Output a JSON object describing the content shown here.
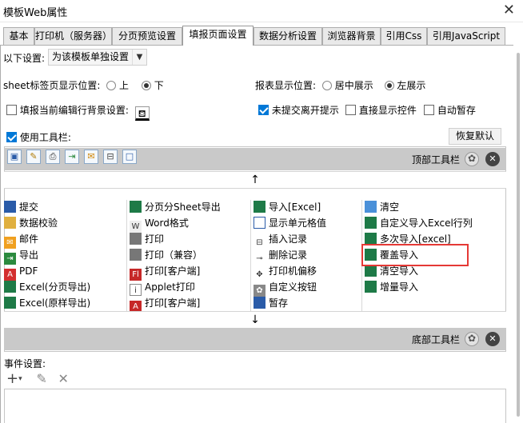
{
  "window": {
    "title": "模板Web属性",
    "close": "✕"
  },
  "tabs": [
    {
      "label": "基本"
    },
    {
      "label": "打印机（服务器）"
    },
    {
      "label": "分页预览设置"
    },
    {
      "label": "填报页面设置"
    },
    {
      "label": "数据分析设置"
    },
    {
      "label": "浏览器背景"
    },
    {
      "label": "引用Css"
    },
    {
      "label": "引用JavaScript"
    }
  ],
  "settings": {
    "label": "以下设置:",
    "select_value": "为该模板单独设置",
    "sheet_pos_label": "sheet标签页显示位置:",
    "sheet_top": "上",
    "sheet_bottom": "下",
    "report_pos_label": "报表显示位置:",
    "report_center": "居中展示",
    "report_left": "左展示",
    "fill_bg_label": "填报当前编辑行背景设置:",
    "unsubmitted_label": "未提交离开提示",
    "direct_widget_label": "直接显示控件",
    "autosave_label": "自动暂存",
    "use_toolbar_label": "使用工具栏:",
    "restore_default": "恢复默认"
  },
  "top_toolbar": {
    "label": "顶部工具栏"
  },
  "bottom_toolbar": {
    "label": "底部工具栏"
  },
  "arrows": {
    "up": "↑",
    "down": "↓"
  },
  "buttons": [
    [
      "提交",
      "分页分Sheet导出",
      "导入[Excel]",
      "清空"
    ],
    [
      "数据校验",
      "Word格式",
      "显示单元格值",
      "自定义导入Excel行列"
    ],
    [
      "邮件",
      "打印",
      "插入记录",
      "多次导入[excel]"
    ],
    [
      "导出",
      "打印（兼容）",
      "删除记录",
      "覆盖导入"
    ],
    [
      "PDF",
      "打印[客户端]",
      "打印机偏移",
      "清空导入"
    ],
    [
      "Excel(分页导出)",
      "Applet打印",
      "自定义按钮",
      "增量导入"
    ],
    [
      "Excel(原样导出)",
      "打印[客户端]",
      "暂存",
      ""
    ]
  ],
  "events": {
    "label": "事件设置:",
    "add": "+",
    "edit": "✎",
    "delete": "✕"
  },
  "colors": {
    "highlight": "#e53935",
    "accent": "#0078d7",
    "strip": "#c9c9c9"
  }
}
